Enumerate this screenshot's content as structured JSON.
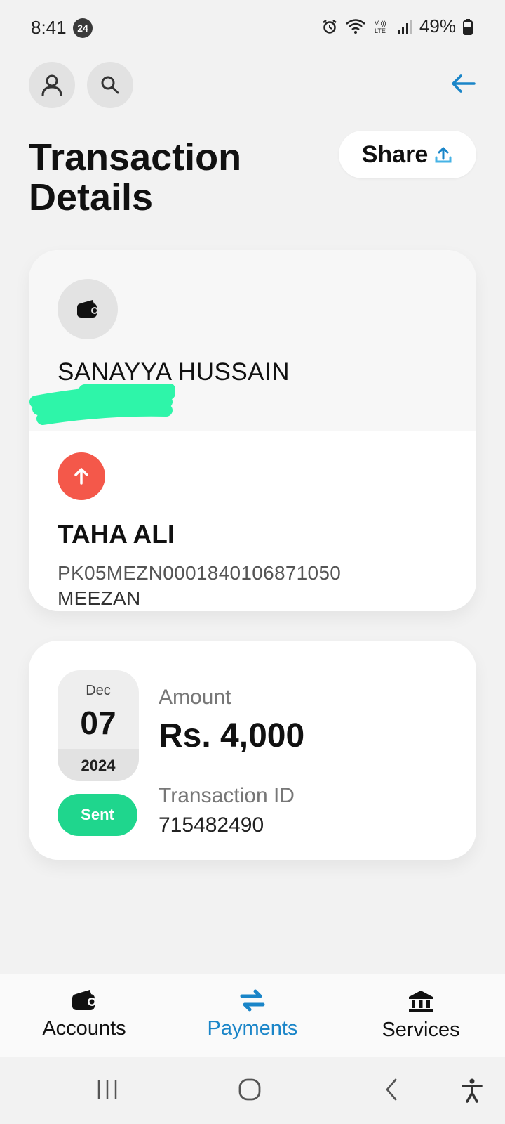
{
  "status_bar": {
    "time": "8:41",
    "notification_count": "24",
    "battery": "49%"
  },
  "header": {
    "title": "Transaction Details",
    "share_label": "Share"
  },
  "from": {
    "name": "SANAYYA HUSSAIN"
  },
  "to": {
    "name": "TAHA ALI",
    "iban": "PK05MEZN0001840106871050",
    "bank": "MEEZAN"
  },
  "transaction": {
    "month": "Dec",
    "day": "07",
    "year": "2024",
    "status": "Sent",
    "amount_label": "Amount",
    "amount": "Rs. 4,000",
    "txid_label": "Transaction ID",
    "txid": "715482490"
  },
  "bottom_nav": {
    "items": [
      {
        "label": "Accounts",
        "icon": "wallet-icon"
      },
      {
        "label": "Payments",
        "icon": "transfer-icon",
        "active": true
      },
      {
        "label": "Services",
        "icon": "bank-icon"
      }
    ]
  },
  "colors": {
    "accent": "#1a85c8",
    "sent_status": "#1fd68d",
    "outgoing": "#f4584a"
  }
}
